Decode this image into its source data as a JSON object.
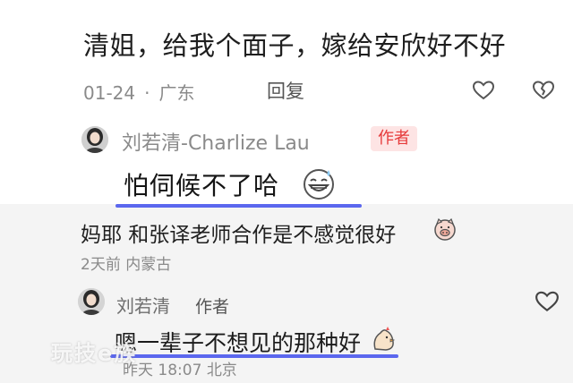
{
  "comment1": {
    "text": "清姐，给我个面子，嫁给安欣好不好",
    "date": "01-24",
    "separator": "·",
    "location": "广东",
    "reply_label": "回复"
  },
  "reply1": {
    "author": "刘若清-Charlize Lau",
    "author_badge": "作者",
    "text": "怕伺候不了哈",
    "emoji": "grinning-sweat-emoji"
  },
  "comment2": {
    "text": "妈耶 和张译老师合作是不感觉很好",
    "emoji": "pig-face-emoji",
    "time": "2天前",
    "location": "内蒙古"
  },
  "reply2": {
    "author": "刘若清",
    "author_badge": "作者",
    "text": "嗯一辈子不想见的那种好",
    "emoji": "chicken-emoji",
    "time": "昨天 18:07",
    "location": "北京"
  },
  "watermark": "玩技e族",
  "colors": {
    "underline": "#5b67ee",
    "author_badge_bg": "#fde4e4",
    "author_badge_text": "#e63a3a",
    "meta_text": "#8a8a8a"
  }
}
